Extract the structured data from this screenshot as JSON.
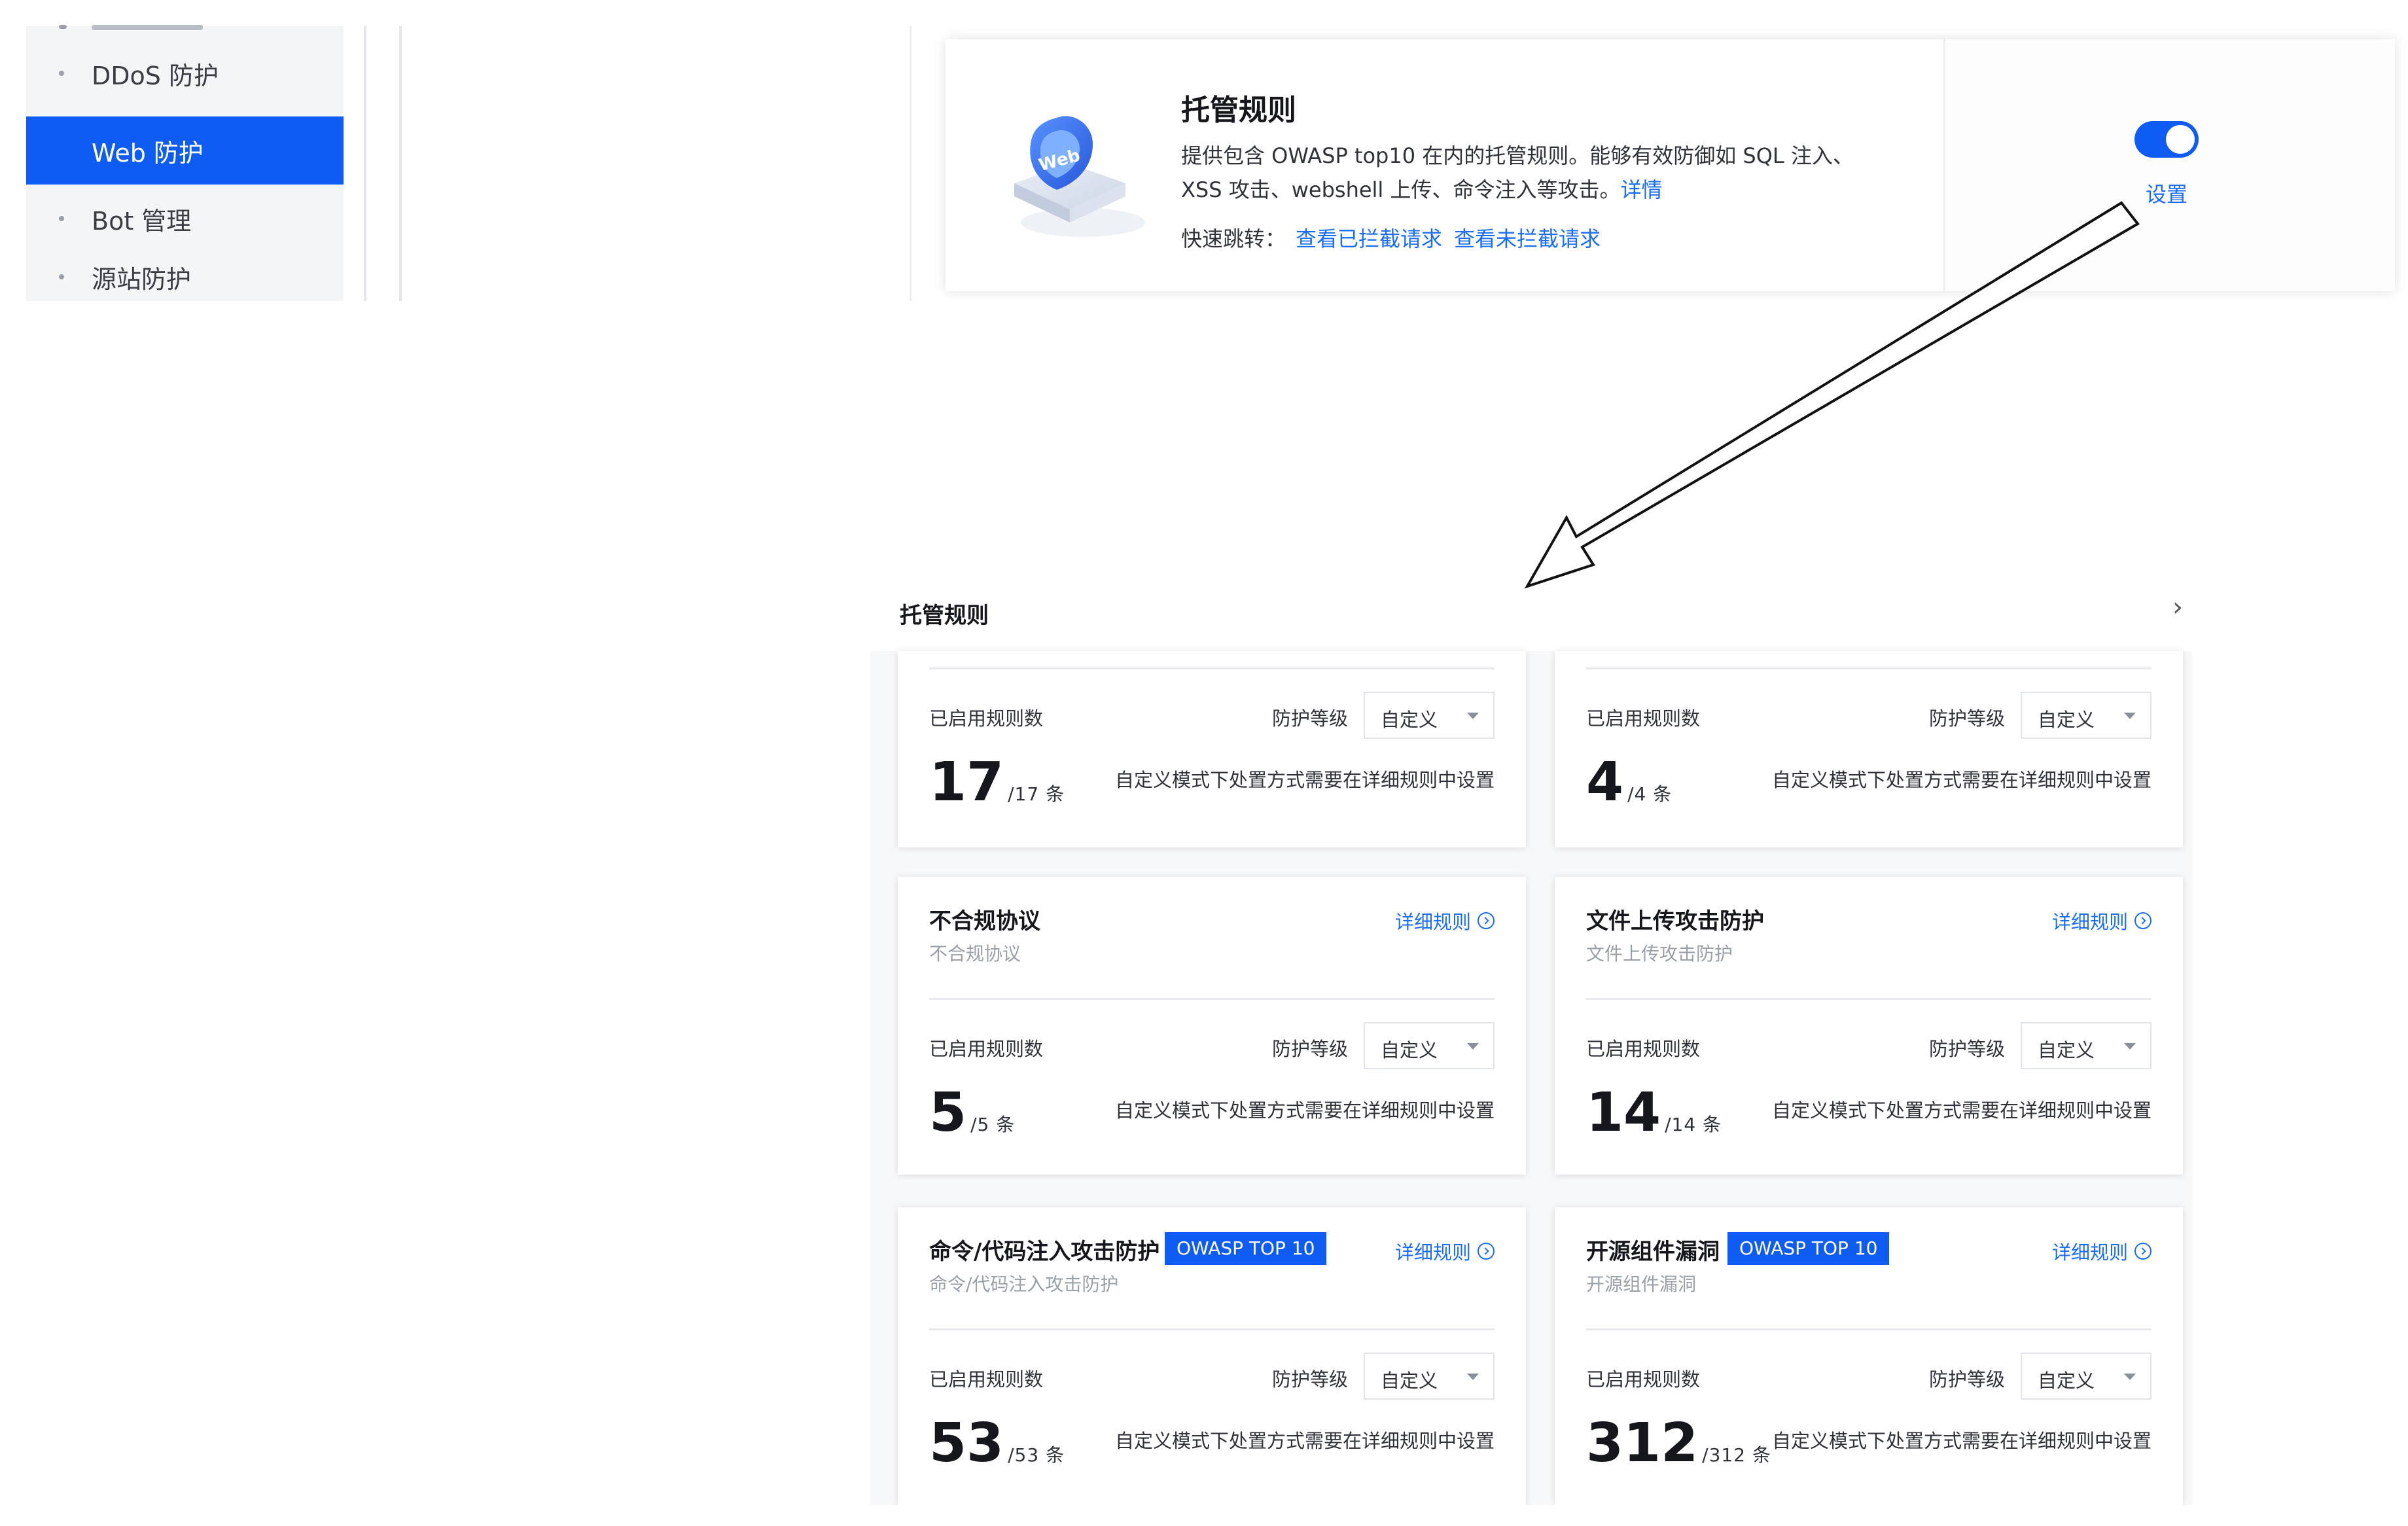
{
  "sidebar": {
    "items": [
      {
        "label": "DDoS 防护",
        "active": false
      },
      {
        "label": "Web 防护",
        "active": true
      },
      {
        "label": "Bot 管理",
        "active": false
      },
      {
        "label": "源站防护",
        "active": false
      }
    ]
  },
  "top_card": {
    "title": "托管规则",
    "desc_line1": "提供包含 OWASP top10 在内的托管规则。能够有效防御如 SQL 注入、",
    "desc_line2": "XSS 攻击、webshell 上传、命令注入等攻击。",
    "desc_link": "详情",
    "quick_label": "快速跳转：",
    "quick_link_blocked": "查看已拦截请求",
    "quick_link_unblocked": "查看未拦截请求",
    "toggle_on": true,
    "setting_label": "设置",
    "icon": "web-shield-icon"
  },
  "panel": {
    "title": "托管规则",
    "chevron": "›"
  },
  "labels": {
    "enabled": "已启用规则数",
    "level": "防护等级",
    "level_value": "自定义",
    "unit": "条",
    "note": "自定义模式下处置方式需要在详细规则中设置",
    "detail": "详细规则"
  },
  "cards": [
    {
      "title": "",
      "subtitle": "",
      "badge": "",
      "count": "17",
      "total": "/17"
    },
    {
      "title": "",
      "subtitle": "",
      "badge": "",
      "count": "4",
      "total": "/4"
    },
    {
      "title": "不合规协议",
      "subtitle": "不合规协议",
      "badge": "",
      "count": "5",
      "total": "/5"
    },
    {
      "title": "文件上传攻击防护",
      "subtitle": "文件上传攻击防护",
      "badge": "",
      "count": "14",
      "total": "/14"
    },
    {
      "title": "命令/代码注入攻击防护",
      "subtitle": "命令/代码注入攻击防护",
      "badge": "OWASP TOP 10",
      "count": "53",
      "total": "/53"
    },
    {
      "title": "开源组件漏洞",
      "subtitle": "开源组件漏洞",
      "badge": "OWASP TOP 10",
      "count": "312",
      "total": "/312"
    }
  ],
  "colors": {
    "accent": "#0f5cf5",
    "link": "#1a6ef5"
  }
}
